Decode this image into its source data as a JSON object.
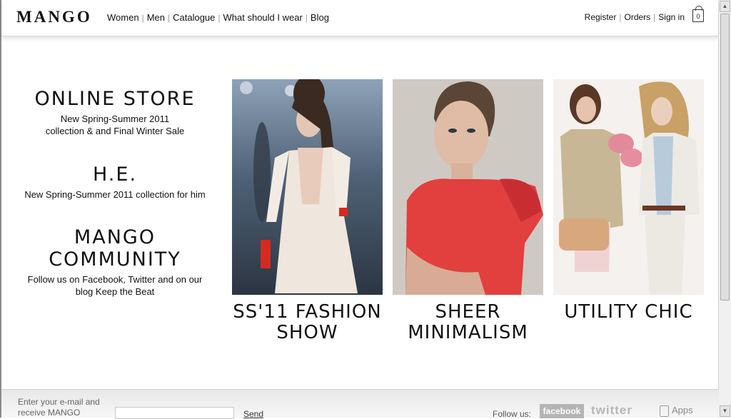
{
  "brand": {
    "logo": "MANGO"
  },
  "nav": {
    "items": [
      "Women",
      "Men",
      "Catalogue",
      "What should I wear",
      "Blog"
    ],
    "separator": "|"
  },
  "user_links": {
    "register": "Register",
    "orders": "Orders",
    "sign_in": "Sign in",
    "bag_count": "0"
  },
  "promos": [
    {
      "title": "ONLINE STORE",
      "text": "New Spring-Summer 2011 collection & and Final Winter Sale"
    },
    {
      "title": "H.E.",
      "text": "New Spring-Summer 2011 collection for him"
    },
    {
      "title": "MANGO COMMUNITY",
      "text": "Follow us on Facebook, Twitter and on our blog Keep the Beat"
    }
  ],
  "features": [
    {
      "title": "SS'11 FASHION SHOW"
    },
    {
      "title": "SHEER MINIMALISM"
    },
    {
      "title": "UTILITY CHIC"
    }
  ],
  "footer": {
    "newsletter_line1": "Enter your e-mail and",
    "newsletter_line2": "receive MANGO",
    "email_value": "",
    "send": "Send",
    "follow_us": "Follow us:",
    "facebook": "facebook",
    "twitter": "twitter",
    "apps": "Apps"
  },
  "colors": {
    "text": "#111111",
    "accent_red": "#e53c3c",
    "footer_bg": "#eeeeee"
  }
}
